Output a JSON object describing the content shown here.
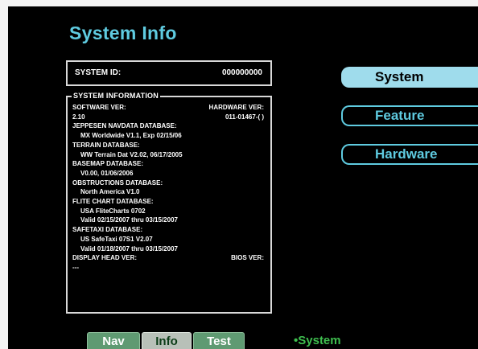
{
  "page_title": "System Info",
  "system_id": {
    "label": "SYSTEM ID:",
    "value": "000000000"
  },
  "system_information": {
    "title": "SYSTEM INFORMATION",
    "software_ver_label": "SOFTWARE VER:",
    "hardware_ver_label": "HARDWARE VER:",
    "software_ver_value": "2.10",
    "hardware_ver_value": "011-01467-( )",
    "jeppesen_label": "JEPPESEN NAVDATA DATABASE:",
    "jeppesen_value": "MX Worldwide V1.1, Exp 02/15/06",
    "terrain_label": "TERRAIN DATABASE:",
    "terrain_value": "WW Terrain Dat V2.02, 06/17/2005",
    "basemap_label": "BASEMAP DATABASE:",
    "basemap_value": "V0.00, 01/06/2006",
    "obstructions_label": "OBSTRUCTIONS DATABASE:",
    "obstructions_value": "North America V1.0",
    "flite_label": "FLITE CHART DATABASE:",
    "flite_value_1": "USA FliteCharts 0702",
    "flite_value_2": "Valid 02/15/2007 thru 03/15/2007",
    "safetaxi_label": "SAFETAXI DATABASE:",
    "safetaxi_value_1": "US SafeTaxi 07S1 V2.07",
    "safetaxi_value_2": "Valid 01/18/2007 thru 03/15/2007",
    "display_head_label": "DISPLAY HEAD VER:",
    "bios_label": "BIOS VER:",
    "display_head_value": "---"
  },
  "side_buttons": {
    "system": "System",
    "feature": "Feature",
    "hardware": "Hardware"
  },
  "tabs": {
    "nav": "Nav",
    "info": "Info",
    "test": "Test"
  },
  "breadcrumb": "•System",
  "colors": {
    "accent": "#5fcbe0",
    "active_button": "#9fdcec",
    "tab_green": "#5f9a72",
    "breadcrumb_green": "#3fbf4f"
  }
}
